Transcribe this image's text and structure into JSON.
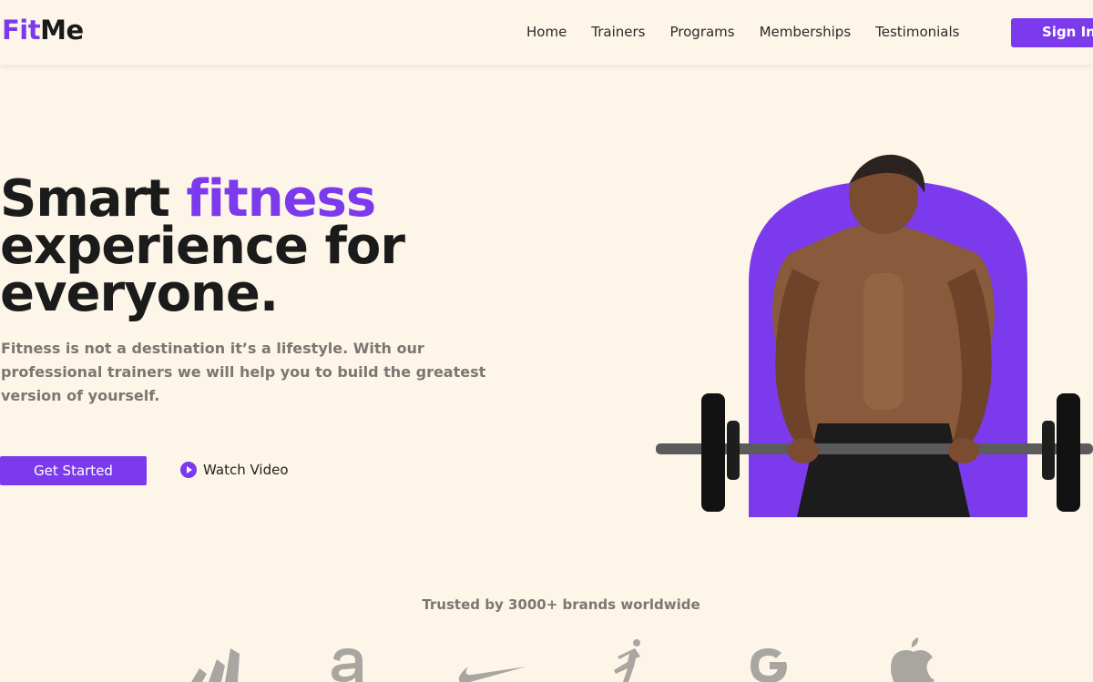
{
  "brand": {
    "fit": "Fit",
    "me": "Me"
  },
  "nav": {
    "items": [
      "Home",
      "Trainers",
      "Programs",
      "Memberships",
      "Testimonials"
    ],
    "signin": "Sign In"
  },
  "hero": {
    "title_part1": "Smart ",
    "title_accent": "fitness",
    "title_line2": "experience for",
    "title_line3": "everyone.",
    "description": "Fitness is not a destination it’s a lifestyle. With our professional trainers we will help you to build the greatest version of yourself.",
    "cta_primary": "Get Started",
    "cta_secondary": "Watch Video"
  },
  "trusted": {
    "text": "Trusted by 3000+ brands worldwide",
    "brand_icons": [
      "adidas-icon",
      "amazon-icon",
      "nike-icon",
      "jordan-icon",
      "google-icon",
      "apple-icon"
    ]
  },
  "colors": {
    "accent": "#7c3aed",
    "background": "#fdf6e8",
    "muted": "#7a7672"
  }
}
